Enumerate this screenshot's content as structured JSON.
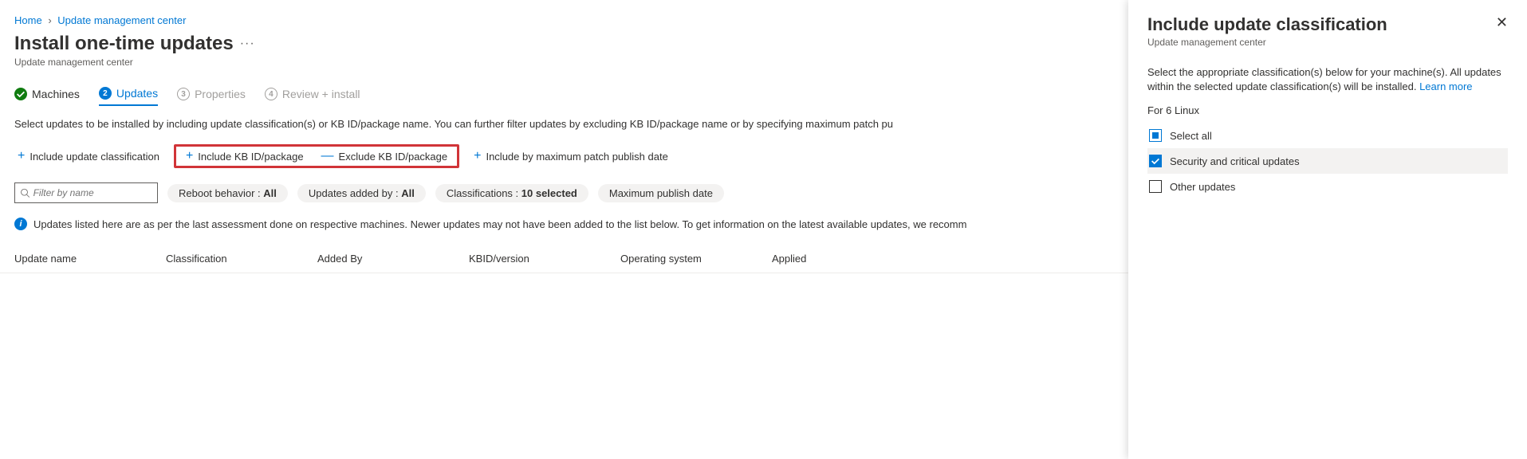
{
  "breadcrumb": {
    "home": "Home",
    "item": "Update management center"
  },
  "title": "Install one-time updates",
  "subtitle": "Update management center",
  "steps": [
    {
      "label": "Machines",
      "state": "done"
    },
    {
      "label": "Updates",
      "num": "2",
      "state": "current"
    },
    {
      "label": "Properties",
      "num": "3",
      "state": "future"
    },
    {
      "label": "Review + install",
      "num": "4",
      "state": "future"
    }
  ],
  "section_desc": "Select updates to be installed by including update classification(s) or KB ID/package name. You can further filter updates by excluding KB ID/package name or by specifying maximum patch pu",
  "actions": {
    "classification": "Include update classification",
    "include_kb": "Include KB ID/package",
    "exclude_kb": "Exclude KB ID/package",
    "include_date": "Include by maximum patch publish date"
  },
  "filter_placeholder": "Filter by name",
  "pills": {
    "reboot_label": "Reboot behavior : ",
    "reboot_value": "All",
    "added_label": "Updates added by : ",
    "added_value": "All",
    "class_label": "Classifications : ",
    "class_value": "10 selected",
    "publish": "Maximum publish date"
  },
  "info_text": "Updates listed here are as per the last assessment done on respective machines. Newer updates may not have been added to the list below. To get information on the latest available updates, we recomm",
  "columns": [
    "Update name",
    "Classification",
    "Added By",
    "KBID/version",
    "Operating system",
    "Applied"
  ],
  "panel": {
    "title": "Include update classification",
    "subtitle": "Update management center",
    "desc": "Select the appropriate classification(s) below for your machine(s). All updates within the selected update classification(s) will be installed. ",
    "learn": "Learn more",
    "for": "For 6 Linux",
    "select_all": "Select all",
    "options": [
      {
        "label": "Security and critical updates",
        "checked": true
      },
      {
        "label": "Other updates",
        "checked": false
      }
    ]
  }
}
